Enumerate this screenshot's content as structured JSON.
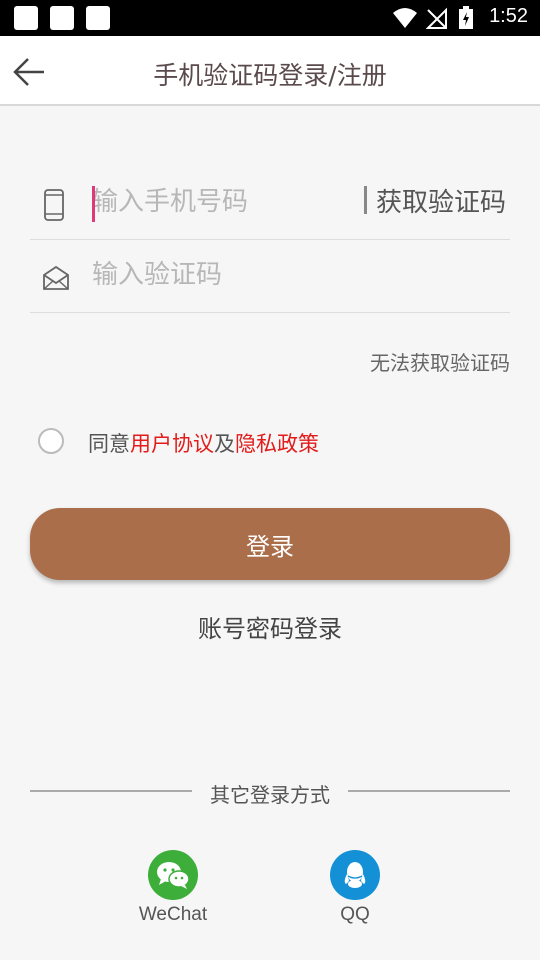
{
  "status_bar": {
    "time": "1:52"
  },
  "header": {
    "title": "手机验证码登录/注册"
  },
  "form": {
    "phone_placeholder": "输入手机号码",
    "get_code_label": "获取验证码",
    "code_placeholder": "输入验证码",
    "cant_get_code": "无法获取验证码"
  },
  "agreement": {
    "prefix": "同意",
    "user_agreement": "用户协议",
    "and": "及",
    "privacy_policy": "隐私政策",
    "link_color": "#e21b1b"
  },
  "login_button": {
    "label": "登录",
    "color": "#ab6e4a"
  },
  "password_login": "账号密码登录",
  "other_login": {
    "label": "其它登录方式",
    "providers": [
      {
        "name": "WeChat",
        "icon": "wechat-icon",
        "color": "#3dae3a"
      },
      {
        "name": "QQ",
        "icon": "qq-icon",
        "color": "#1490d6"
      }
    ]
  }
}
